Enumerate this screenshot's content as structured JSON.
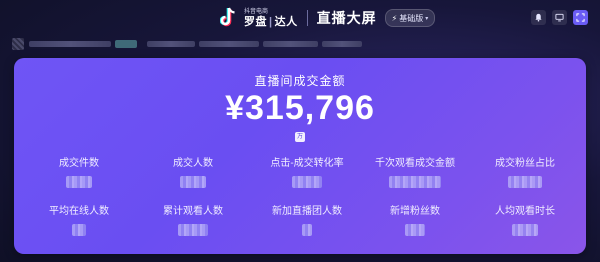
{
  "header": {
    "brand_small": "抖音电商",
    "brand_main_left": "罗盘",
    "brand_sep": "|",
    "brand_main_right": "达人",
    "page_title": "直播大屏",
    "version_label": "基础版",
    "version_icon": "bolt-icon",
    "actions": [
      {
        "name": "notification-bell-icon",
        "glyph": "🔔"
      },
      {
        "name": "monitor-icon",
        "glyph": "▭"
      },
      {
        "name": "fullscreen-icon",
        "glyph": "⤢"
      }
    ]
  },
  "account_row": {
    "content_blurred": true
  },
  "card": {
    "title": "直播间成交金额",
    "gmv": "¥315,796",
    "unit_badge": "万",
    "metrics_row1": [
      {
        "label": "成交件数"
      },
      {
        "label": "成交人数"
      },
      {
        "label": "点击-成交转化率"
      },
      {
        "label": "千次观看成交金额"
      },
      {
        "label": "成交粉丝占比"
      }
    ],
    "metrics_row2": [
      {
        "label": "平均在线人数"
      },
      {
        "label": "累计观看人数"
      },
      {
        "label": "新加直播团人数"
      },
      {
        "label": "新增粉丝数"
      },
      {
        "label": "人均观看时长"
      }
    ]
  },
  "colors": {
    "background": "#17163a",
    "card_start": "#6f55f5",
    "card_end": "#8a55e9",
    "accent": "#6a5cf5"
  }
}
